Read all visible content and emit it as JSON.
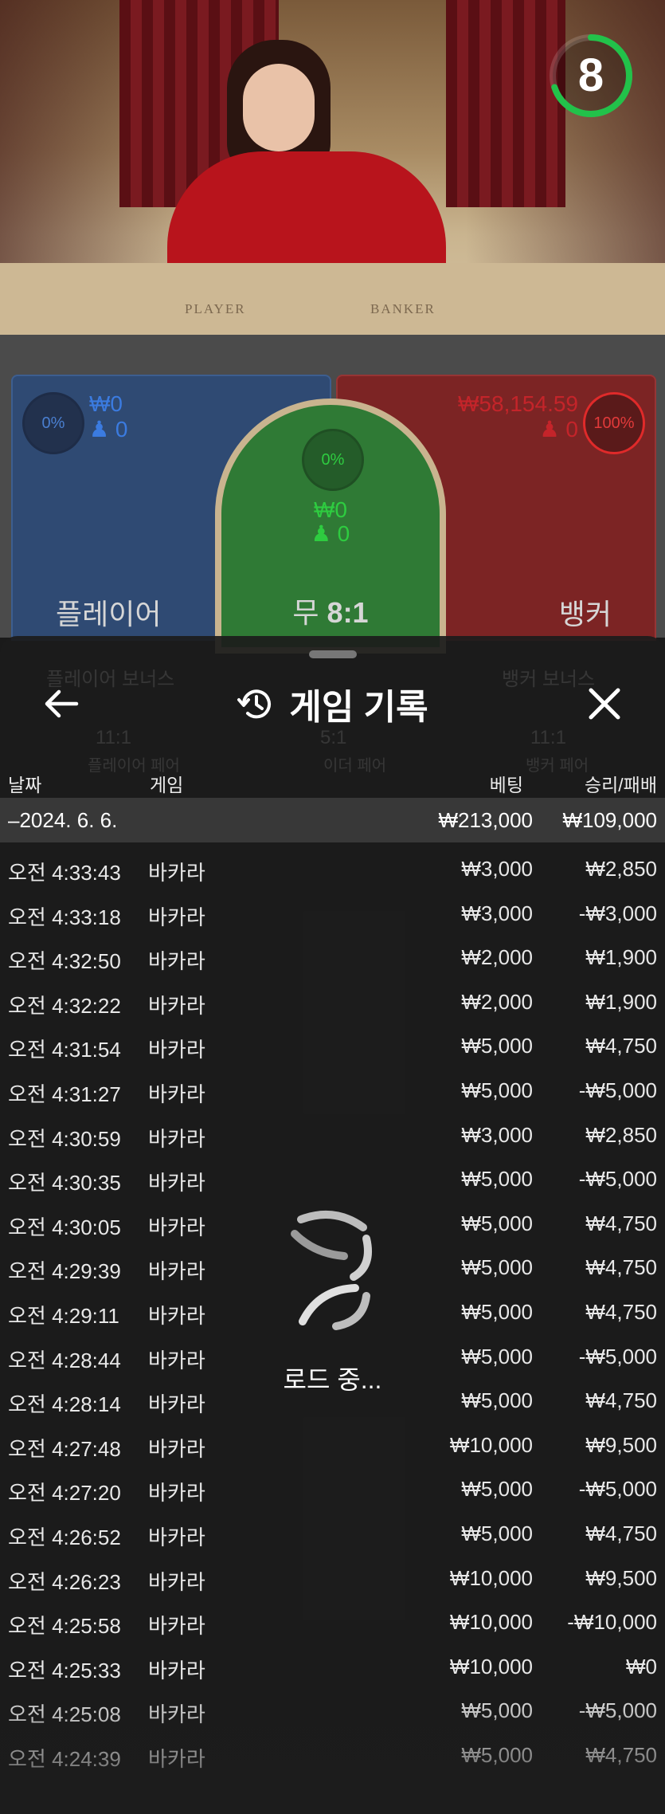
{
  "video": {
    "table_label_player": "PLAYER",
    "table_label_banker": "BANKER",
    "countdown": "8",
    "countdown_fraction": 0.7,
    "accent_color": "#22c24a"
  },
  "bets": {
    "player": {
      "percent": "0%",
      "amount": "₩0",
      "count": "0",
      "name": "플레이어",
      "color": "#2f4a73"
    },
    "tie": {
      "percent": "0%",
      "amount": "₩0",
      "count": "0",
      "name": "무",
      "odds": "8:1",
      "color": "#2f7a35"
    },
    "banker": {
      "percent": "100%",
      "amount": "₩58,154.59",
      "count": "0",
      "name": "뱅커",
      "color": "#7c2424"
    }
  },
  "background_ghost": {
    "player_bonus": "플레이어 보너스",
    "banker_bonus": "뱅커 보너스",
    "player_pair_odds": "11:1",
    "player_pair": "플레이어 페어",
    "either_pair_odds": "5:1",
    "either_pair": "이더 페어",
    "banker_pair_odds": "11:1",
    "banker_pair": "뱅커 페어"
  },
  "history": {
    "title": "게임 기록",
    "back_icon": "arrow-left-icon",
    "history_icon": "history-clock-icon",
    "close_icon": "close-icon",
    "columns": {
      "date": "날짜",
      "game": "게임",
      "bet": "베팅",
      "win_loss": "승리/패배"
    },
    "date_group": {
      "date": "2024. 6. 6.",
      "bet_total": "₩213,000",
      "win_total": "₩109,000"
    },
    "rows": [
      {
        "time": "오전 4:33:43",
        "game": "바카라",
        "bet": "₩3,000",
        "result": "₩2,850"
      },
      {
        "time": "오전 4:33:18",
        "game": "바카라",
        "bet": "₩3,000",
        "result": "-₩3,000"
      },
      {
        "time": "오전 4:32:50",
        "game": "바카라",
        "bet": "₩2,000",
        "result": "₩1,900"
      },
      {
        "time": "오전 4:32:22",
        "game": "바카라",
        "bet": "₩2,000",
        "result": "₩1,900"
      },
      {
        "time": "오전 4:31:54",
        "game": "바카라",
        "bet": "₩5,000",
        "result": "₩4,750"
      },
      {
        "time": "오전 4:31:27",
        "game": "바카라",
        "bet": "₩5,000",
        "result": "-₩5,000"
      },
      {
        "time": "오전 4:30:59",
        "game": "바카라",
        "bet": "₩3,000",
        "result": "₩2,850"
      },
      {
        "time": "오전 4:30:35",
        "game": "바카라",
        "bet": "₩5,000",
        "result": "-₩5,000"
      },
      {
        "time": "오전 4:30:05",
        "game": "바카라",
        "bet": "₩5,000",
        "result": "₩4,750"
      },
      {
        "time": "오전 4:29:39",
        "game": "바카라",
        "bet": "₩5,000",
        "result": "₩4,750"
      },
      {
        "time": "오전 4:29:11",
        "game": "바카라",
        "bet": "₩5,000",
        "result": "₩4,750"
      },
      {
        "time": "오전 4:28:44",
        "game": "바카라",
        "bet": "₩5,000",
        "result": "-₩5,000"
      },
      {
        "time": "오전 4:28:14",
        "game": "바카라",
        "bet": "₩5,000",
        "result": "₩4,750"
      },
      {
        "time": "오전 4:27:48",
        "game": "바카라",
        "bet": "₩10,000",
        "result": "₩9,500"
      },
      {
        "time": "오전 4:27:20",
        "game": "바카라",
        "bet": "₩5,000",
        "result": "-₩5,000"
      },
      {
        "time": "오전 4:26:52",
        "game": "바카라",
        "bet": "₩5,000",
        "result": "₩4,750"
      },
      {
        "time": "오전 4:26:23",
        "game": "바카라",
        "bet": "₩10,000",
        "result": "₩9,500"
      },
      {
        "time": "오전 4:25:58",
        "game": "바카라",
        "bet": "₩10,000",
        "result": "-₩10,000"
      },
      {
        "time": "오전 4:25:33",
        "game": "바카라",
        "bet": "₩10,000",
        "result": "₩0"
      },
      {
        "time": "오전 4:25:08",
        "game": "바카라",
        "bet": "₩5,000",
        "result": "-₩5,000"
      },
      {
        "time": "오전 4:24:39",
        "game": "바카라",
        "bet": "₩5,000",
        "result": "₩4,750"
      }
    ],
    "loading_text": "로드 중...",
    "loading_icon": "spinner-icon"
  }
}
